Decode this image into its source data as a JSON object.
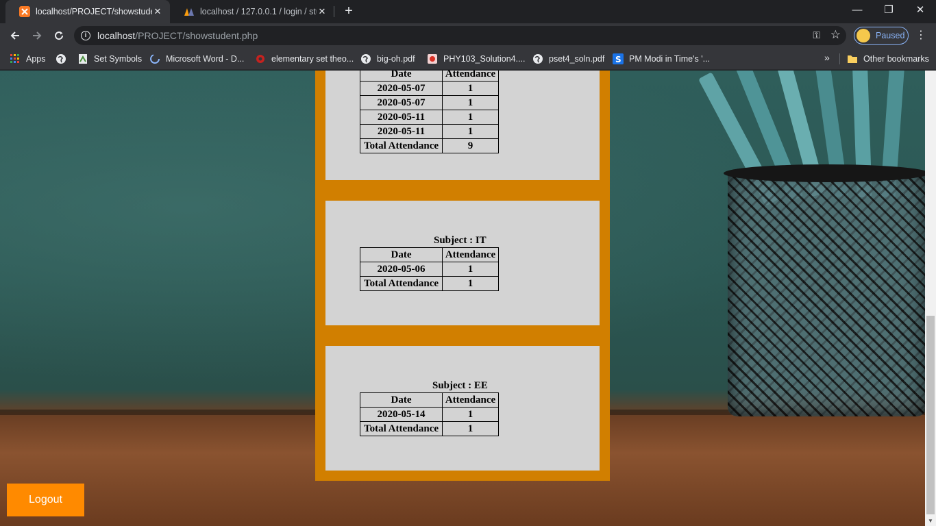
{
  "browser": {
    "tabs": [
      {
        "title": "localhost/PROJECT/showstudent.",
        "active": true
      },
      {
        "title": "localhost / 127.0.0.1 / login / stuc",
        "active": false
      }
    ],
    "new_tab_label": "+",
    "window_controls": {
      "minimize": "—",
      "restore": "❐",
      "close": "✕"
    },
    "url_host": "localhost",
    "url_path": "/PROJECT/showstudent.php",
    "profile_label": "Paused",
    "bookmarks": [
      {
        "label": "Apps",
        "icon": "apps-grid-icon"
      },
      {
        "label": "",
        "icon": "globe-icon"
      },
      {
        "label": "Set Symbols",
        "icon": "page-icon"
      },
      {
        "label": "Microsoft Word - D...",
        "icon": "loading-icon"
      },
      {
        "label": "elementary set theo...",
        "icon": "gear-red-icon"
      },
      {
        "label": "big-oh.pdf",
        "icon": "globe-icon"
      },
      {
        "label": "PHY103_Solution4....",
        "icon": "pdf-icon"
      },
      {
        "label": "pset4_soln.pdf",
        "icon": "globe-icon"
      },
      {
        "label": "PM Modi in Time's '...",
        "icon": "s-logo-icon"
      }
    ],
    "bookmarks_overflow": "»",
    "other_bookmarks": "Other bookmarks"
  },
  "page": {
    "headers": {
      "date": "Date",
      "attendance": "Attendance",
      "total": "Total Attendance"
    },
    "subjects": [
      {
        "subject": "",
        "rows": [
          {
            "date": "2020-05-07",
            "attendance": "1"
          },
          {
            "date": "2020-05-07",
            "attendance": "1"
          },
          {
            "date": "2020-05-11",
            "attendance": "1"
          },
          {
            "date": "2020-05-11",
            "attendance": "1"
          }
        ],
        "total": "9"
      },
      {
        "subject": "Subject : IT",
        "rows": [
          {
            "date": "2020-05-06",
            "attendance": "1"
          }
        ],
        "total": "1"
      },
      {
        "subject": "Subject : EE",
        "rows": [
          {
            "date": "2020-05-14",
            "attendance": "1"
          }
        ],
        "total": "1"
      }
    ],
    "logout_label": "Logout"
  },
  "colors": {
    "panel": "#d17f00",
    "card": "#d3d3d3",
    "logout": "#ff8a00"
  }
}
